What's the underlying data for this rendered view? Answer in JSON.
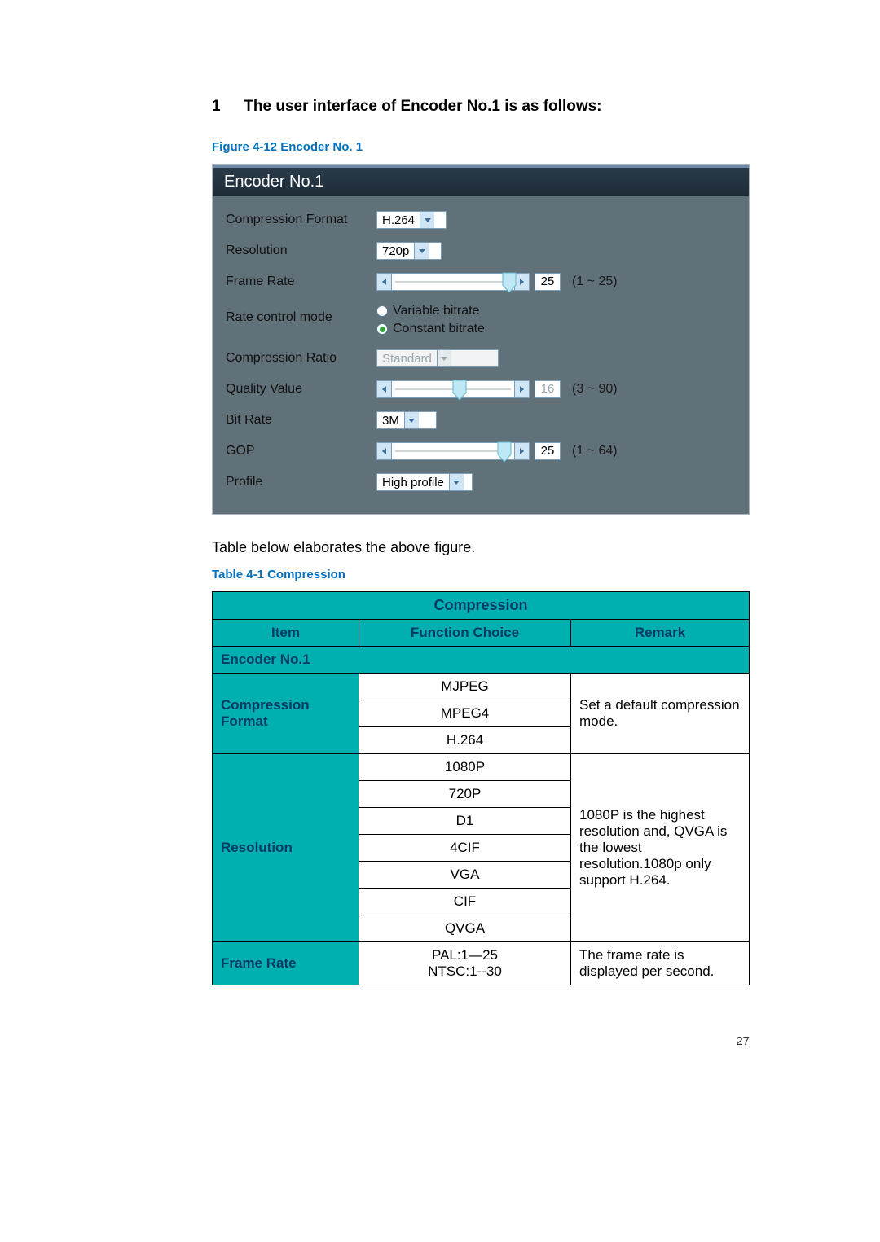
{
  "heading": {
    "num": "1",
    "text": "The user interface of Encoder No.1 is as follows",
    "colon": ":"
  },
  "figure_caption": "Figure 4-12 Encoder No. 1",
  "panel": {
    "title": "Encoder No.1",
    "rows": {
      "compression_format": {
        "label": "Compression Format",
        "value": "H.264"
      },
      "resolution": {
        "label": "Resolution",
        "value": "720p"
      },
      "frame_rate": {
        "label": "Frame Rate",
        "value": "25",
        "range": "(1 ~ 25)"
      },
      "rate_mode": {
        "label": "Rate control mode",
        "opt1": "Variable bitrate",
        "opt2": "Constant bitrate"
      },
      "compression_ratio": {
        "label": "Compression Ratio",
        "value": "Standard"
      },
      "quality_value": {
        "label": "Quality Value",
        "value": "16",
        "range": "(3 ~ 90)"
      },
      "bit_rate": {
        "label": "Bit Rate",
        "value": "3M"
      },
      "gop": {
        "label": "GOP",
        "value": "25",
        "range": "(1 ~ 64)"
      },
      "profile": {
        "label": "Profile",
        "value": "High profile"
      }
    }
  },
  "body_text": "Table below elaborates the above figure.",
  "table_caption": "Table 4-1 Compression",
  "comp_table": {
    "title": "Compression",
    "headers": {
      "item": "Item",
      "choice": "Function Choice",
      "remark": "Remark"
    },
    "section": "Encoder No.1",
    "compression_format": {
      "label": "Compression Format",
      "choices": [
        "MJPEG",
        "MPEG4",
        "H.264"
      ],
      "remark": "Set a default compression mode."
    },
    "resolution": {
      "label": "Resolution",
      "choices": [
        "1080P",
        "720P",
        "D1",
        "4CIF",
        "VGA",
        "CIF",
        "QVGA"
      ],
      "remark": "1080P is the highest resolution and, QVGA is the lowest resolution.1080p only support H.264."
    },
    "frame_rate": {
      "label": "Frame Rate",
      "choice_line1": "PAL:1—25",
      "choice_line2": "NTSC:1--30",
      "remark": "The frame rate is displayed per second."
    }
  },
  "page_number": "27"
}
